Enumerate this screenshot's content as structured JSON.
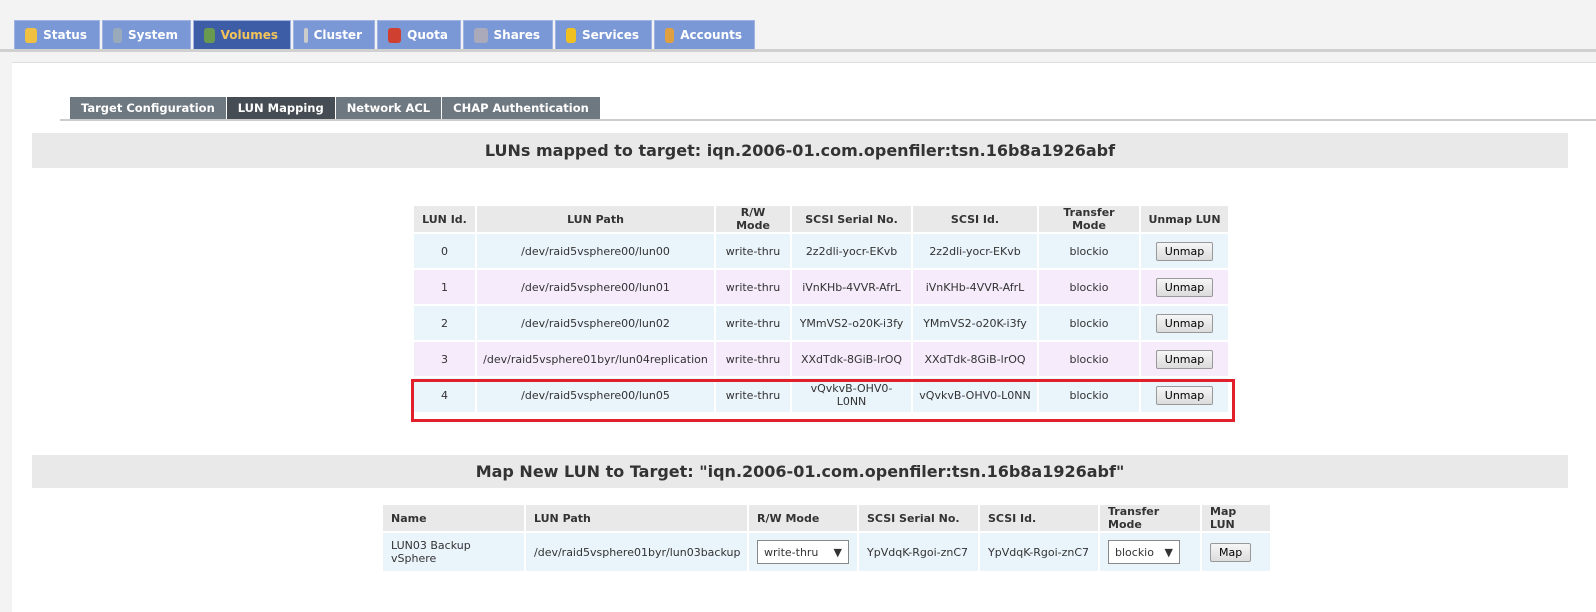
{
  "nav": {
    "tabs": [
      {
        "label": "Status",
        "icon": "weather-icon",
        "color": "#f0c040"
      },
      {
        "label": "System",
        "icon": "computer-icon",
        "color": "#9ab"
      },
      {
        "label": "Volumes",
        "icon": "disk-icon",
        "color": "#6a9a50",
        "active": true
      },
      {
        "label": "Cluster",
        "icon": "server-icon",
        "color": "#ccc"
      },
      {
        "label": "Quota",
        "icon": "pie-icon",
        "color": "#d04030"
      },
      {
        "label": "Shares",
        "icon": "network-share-icon",
        "color": "#aab"
      },
      {
        "label": "Services",
        "icon": "lightning-icon",
        "color": "#f0c020"
      },
      {
        "label": "Accounts",
        "icon": "users-icon",
        "color": "#e0a040"
      }
    ]
  },
  "subtabs": [
    {
      "label": "Target Configuration"
    },
    {
      "label": "LUN Mapping",
      "active": true
    },
    {
      "label": "Network ACL"
    },
    {
      "label": "CHAP Authentication"
    }
  ],
  "mapped": {
    "title": "LUNs mapped to target: iqn.2006-01.com.openfiler:tsn.16b8a1926abf",
    "headers": [
      "LUN Id.",
      "LUN Path",
      "R/W Mode",
      "SCSI Serial No.",
      "SCSI Id.",
      "Transfer Mode",
      "Unmap LUN"
    ],
    "rows": [
      [
        "0",
        "/dev/raid5vsphere00/lun00",
        "write-thru",
        "2z2dli-yocr-EKvb",
        "2z2dli-yocr-EKvb",
        "blockio",
        "Unmap"
      ],
      [
        "1",
        "/dev/raid5vsphere00/lun01",
        "write-thru",
        "iVnKHb-4VVR-AfrL",
        "iVnKHb-4VVR-AfrL",
        "blockio",
        "Unmap"
      ],
      [
        "2",
        "/dev/raid5vsphere00/lun02",
        "write-thru",
        "YMmVS2-o20K-i3fy",
        "YMmVS2-o20K-i3fy",
        "blockio",
        "Unmap"
      ],
      [
        "3",
        "/dev/raid5vsphere01byr/lun04replication",
        "write-thru",
        "XXdTdk-8GiB-lrOQ",
        "XXdTdk-8GiB-lrOQ",
        "blockio",
        "Unmap"
      ],
      [
        "4",
        "/dev/raid5vsphere00/lun05",
        "write-thru",
        "vQvkvB-OHV0-L0NN",
        "vQvkvB-OHV0-L0NN",
        "blockio",
        "Unmap"
      ]
    ],
    "highlight_color": "#e0202a"
  },
  "mapnew": {
    "title": "Map New LUN to Target: \"iqn.2006-01.com.openfiler:tsn.16b8a1926abf\"",
    "headers": [
      "Name",
      "LUN Path",
      "R/W Mode",
      "SCSI Serial No.",
      "SCSI Id.",
      "Transfer Mode",
      "Map LUN"
    ],
    "row": {
      "name": "LUN03 Backup vSphere",
      "path": "/dev/raid5vsphere01byr/lun03backup",
      "rw_mode": "write-thru",
      "serial": "YpVdqK-Rgoi-znC7",
      "scsi_id": "YpVdqK-Rgoi-znC7",
      "transfer_mode": "blockio",
      "button": "Map"
    }
  }
}
